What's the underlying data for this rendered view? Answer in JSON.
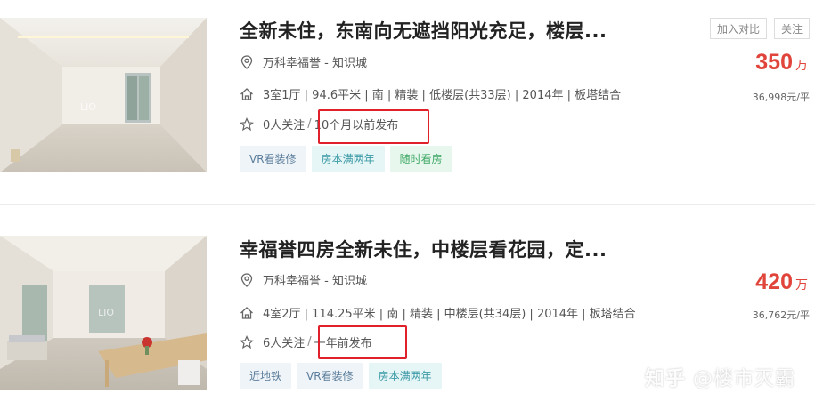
{
  "listings": [
    {
      "title": "全新未住，东南向无遮挡阳光充足，楼层...",
      "community": "万科幸福誉 - 知识城",
      "info": "3室1厅 | 94.6平米 | 南 | 精装 | 低楼层(共33层) | 2014年 | 板塔结合",
      "followers": "0人关注",
      "separator": "/",
      "posted": "10个月以前发布",
      "tags": [
        "VR看装修",
        "房本满两年",
        "随时看房"
      ],
      "price": "350",
      "price_unit": "万",
      "unit_price": "36,998元/平",
      "compare_label": "加入对比",
      "follow_label": "关注"
    },
    {
      "title": "幸福誉四房全新未住，中楼层看花园，定...",
      "community": "万科幸福誉 - 知识城",
      "info": "4室2厅 | 114.25平米 | 南 | 精装 | 中楼层(共34层) | 2014年 | 板塔结合",
      "followers": "6人关注",
      "separator": "/",
      "posted": "一年前发布",
      "tags": [
        "近地铁",
        "VR看装修",
        "房本满两年"
      ],
      "price": "420",
      "price_unit": "万",
      "unit_price": "36,762元/平"
    }
  ],
  "watermark": {
    "logo": "知乎",
    "account": "@楼市灭霸"
  },
  "colors": {
    "price": "#e0443a",
    "highlight": "#e0202a"
  },
  "icons": [
    "location-pin-icon",
    "house-icon",
    "star-icon"
  ]
}
